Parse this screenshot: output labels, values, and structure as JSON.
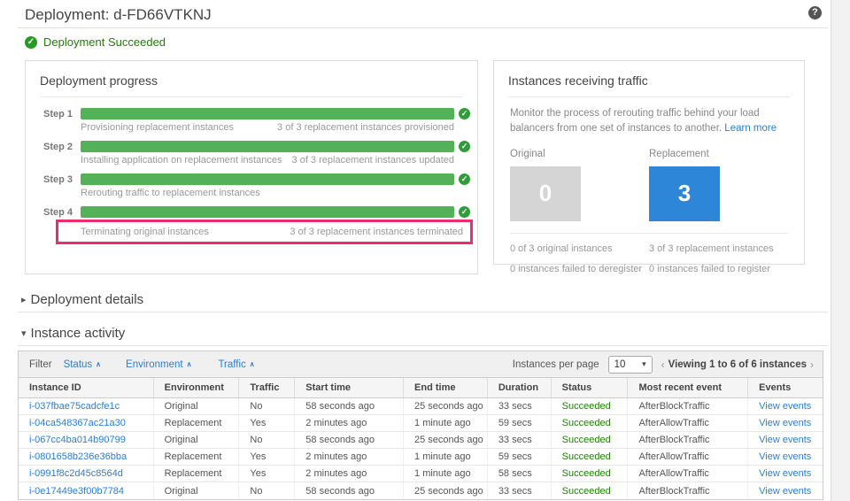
{
  "header": {
    "title": "Deployment: d-FD66VTKNJ",
    "status_text": "Deployment Succeeded"
  },
  "icons": {
    "check": "✓",
    "help": "?",
    "collapsed_arrow": "▸",
    "expanded_arrow": "▾",
    "caret_up": "∧",
    "caret_down": "▾",
    "chevron_left": "‹",
    "chevron_right": "›"
  },
  "progress_panel": {
    "title": "Deployment progress",
    "steps": [
      {
        "label": "Step 1",
        "name": "Provisioning replacement instances",
        "detail": "3 of 3 replacement instances provisioned"
      },
      {
        "label": "Step 2",
        "name": "Installing application on replacement instances",
        "detail": "3 of 3 replacement instances updated"
      },
      {
        "label": "Step 3",
        "name": "Rerouting traffic to replacement instances",
        "detail": ""
      },
      {
        "label": "Step 4",
        "name": "Terminating original instances",
        "detail": "3 of 3 replacement instances terminated"
      }
    ]
  },
  "traffic_panel": {
    "title": "Instances receiving traffic",
    "description": "Monitor the process of rerouting traffic behind your load balancers from one set of instances to another.",
    "learn_more_label": "Learn more",
    "original": {
      "label": "Original",
      "count": "0",
      "line1": "0 of 3 original instances",
      "line2": "0 instances failed to deregister"
    },
    "replacement": {
      "label": "Replacement",
      "count": "3",
      "line1": "3 of 3 replacement instances",
      "line2": "0 instances failed to register"
    }
  },
  "sections": {
    "deployment_details": "Deployment details",
    "instance_activity": "Instance activity"
  },
  "activity_table": {
    "filter_label": "Filter",
    "filters": [
      "Status",
      "Environment",
      "Traffic"
    ],
    "per_page_label": "Instances per page",
    "per_page_value": "10",
    "paging_text": "Viewing 1 to 6 of 6 instances",
    "columns": [
      "Instance ID",
      "Environment",
      "Traffic",
      "Start time",
      "End time",
      "Duration",
      "Status",
      "Most recent event",
      "Events"
    ],
    "rows": [
      {
        "id": "i-037fbae75cadcfe1c",
        "environment": "Original",
        "traffic": "No",
        "start_time": "58 seconds ago",
        "end_time": "25 seconds ago",
        "duration": "33 secs",
        "status": "Succeeded",
        "recent_event": "AfterBlockTraffic",
        "events_label": "View events"
      },
      {
        "id": "i-04ca548367ac21a30",
        "environment": "Replacement",
        "traffic": "Yes",
        "start_time": "2 minutes ago",
        "end_time": "1 minute ago",
        "duration": "59 secs",
        "status": "Succeeded",
        "recent_event": "AfterAllowTraffic",
        "events_label": "View events"
      },
      {
        "id": "i-067cc4ba014b90799",
        "environment": "Original",
        "traffic": "No",
        "start_time": "58 seconds ago",
        "end_time": "25 seconds ago",
        "duration": "33 secs",
        "status": "Succeeded",
        "recent_event": "AfterBlockTraffic",
        "events_label": "View events"
      },
      {
        "id": "i-0801658b236e36bba",
        "environment": "Replacement",
        "traffic": "Yes",
        "start_time": "2 minutes ago",
        "end_time": "1 minute ago",
        "duration": "59 secs",
        "status": "Succeeded",
        "recent_event": "AfterAllowTraffic",
        "events_label": "View events"
      },
      {
        "id": "i-0991f8c2d45c8564d",
        "environment": "Replacement",
        "traffic": "Yes",
        "start_time": "2 minutes ago",
        "end_time": "1 minute ago",
        "duration": "58 secs",
        "status": "Succeeded",
        "recent_event": "AfterAllowTraffic",
        "events_label": "View events"
      },
      {
        "id": "i-0e17449e3f00b7784",
        "environment": "Original",
        "traffic": "No",
        "start_time": "58 seconds ago",
        "end_time": "25 seconds ago",
        "duration": "33 secs",
        "status": "Succeeded",
        "recent_event": "AfterBlockTraffic",
        "events_label": "View events"
      }
    ]
  },
  "colors": {
    "success_green_text": "#1d8102",
    "progress_bar_green": "#53b257",
    "check_icon_green": "#2f9e38",
    "highlight_pink": "#ec2d69",
    "replacement_blue": "#2e86d8",
    "original_gray": "#d5d5d5",
    "link_blue": "#2b7dd9"
  }
}
